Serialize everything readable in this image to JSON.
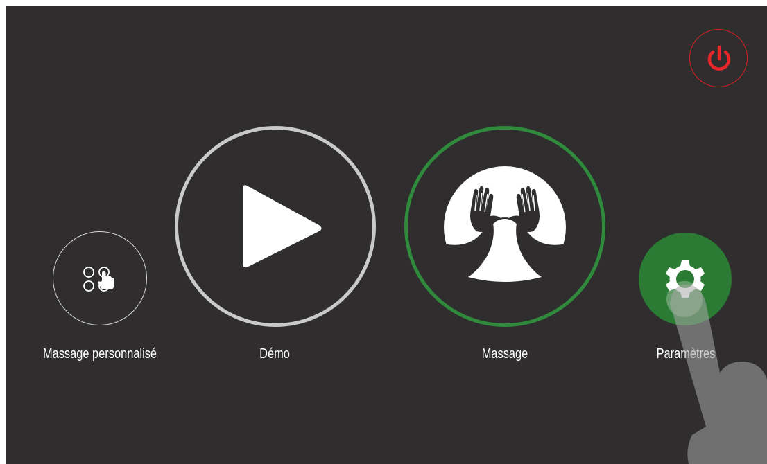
{
  "header": {
    "power_icon": "power-icon",
    "power_color": "#e02020"
  },
  "menu": {
    "items": [
      {
        "label": "Massage personnalisé",
        "icon": "touch-grid-icon"
      },
      {
        "label": "Démo",
        "icon": "play-icon"
      },
      {
        "label": "Massage",
        "icon": "hands-icon",
        "accent": "#2f8a3b"
      },
      {
        "label": "Paramètres",
        "icon": "gear-icon",
        "accent": "#2b7b34"
      }
    ]
  },
  "colors": {
    "background": "#2f2d2e",
    "text": "#ffffff"
  }
}
